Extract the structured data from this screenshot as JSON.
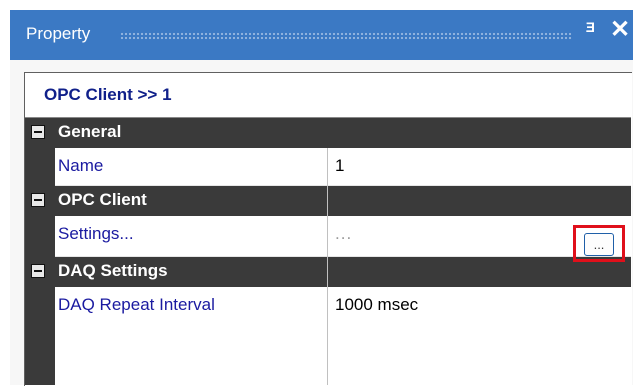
{
  "panel": {
    "title": "Property",
    "pin_glyph": "H",
    "close_glyph": "✕"
  },
  "object_header": "OPC Client >> 1",
  "categories": [
    {
      "label": "General",
      "rows": [
        {
          "name": "Name",
          "value": "1"
        }
      ]
    },
    {
      "label": "OPC Client",
      "rows": [
        {
          "name": "Settings...",
          "value": "...",
          "button_label": "..."
        }
      ]
    },
    {
      "label": "DAQ Settings",
      "rows": [
        {
          "name": "DAQ Repeat Interval",
          "value": "1000 msec"
        }
      ]
    }
  ],
  "icons": {
    "pin": "pin-icon",
    "close": "close-icon",
    "collapse": "collapse-minus-icon"
  },
  "colors": {
    "title_bar": "#3b79c4",
    "category_bg": "#3a3a3a",
    "highlight": "#e0101b",
    "property_name": "#1a1aa0"
  }
}
